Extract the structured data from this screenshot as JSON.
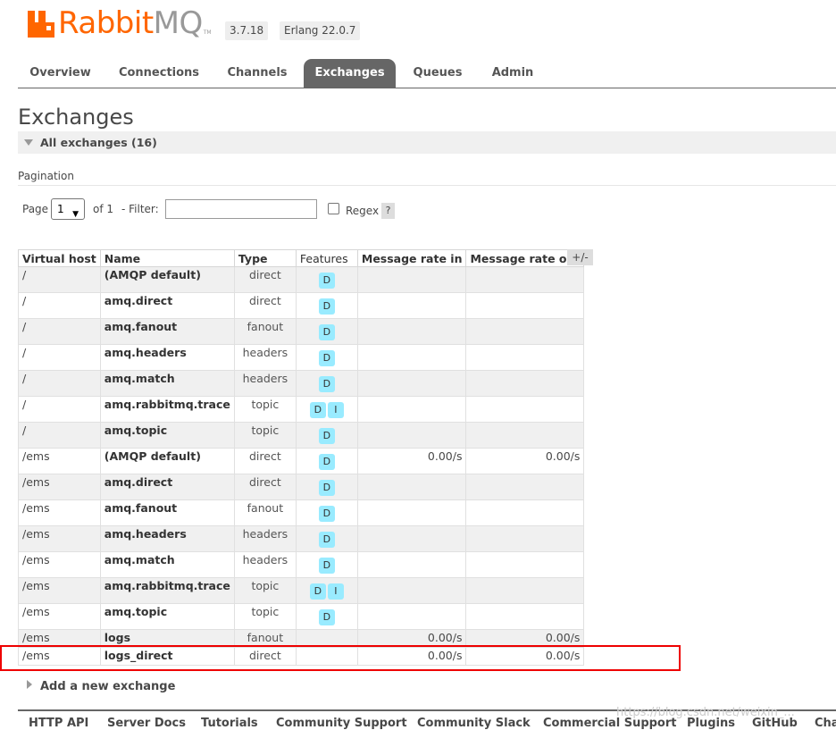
{
  "header": {
    "logo_text_rabbit": "Rabbit",
    "logo_text_mq": "MQ",
    "logo_tm": "TM",
    "version": "3.7.18",
    "erlang": "Erlang 22.0.7"
  },
  "tabs": [
    {
      "label": "Overview"
    },
    {
      "label": "Connections"
    },
    {
      "label": "Channels"
    },
    {
      "label": "Exchanges",
      "active": true
    },
    {
      "label": "Queues"
    },
    {
      "label": "Admin"
    }
  ],
  "page": {
    "title": "Exchanges",
    "section": "All exchanges (16)",
    "pagination_title": "Pagination",
    "page_label": "Page",
    "page_value": "1",
    "of_label": "of 1",
    "filter_label": "- Filter:",
    "filter_value": "",
    "regex_label": "Regex",
    "regex_help": "?"
  },
  "table": {
    "columns": {
      "vhost": "Virtual host",
      "name": "Name",
      "type": "Type",
      "features": "Features",
      "rate_in": "Message rate in",
      "rate_out": "Message rate out"
    },
    "toggle": "+/-",
    "rows": [
      {
        "vhost": "/",
        "name": "(AMQP default)",
        "type": "direct",
        "features": [
          "D"
        ],
        "rate_in": "",
        "rate_out": ""
      },
      {
        "vhost": "/",
        "name": "amq.direct",
        "type": "direct",
        "features": [
          "D"
        ],
        "rate_in": "",
        "rate_out": ""
      },
      {
        "vhost": "/",
        "name": "amq.fanout",
        "type": "fanout",
        "features": [
          "D"
        ],
        "rate_in": "",
        "rate_out": ""
      },
      {
        "vhost": "/",
        "name": "amq.headers",
        "type": "headers",
        "features": [
          "D"
        ],
        "rate_in": "",
        "rate_out": ""
      },
      {
        "vhost": "/",
        "name": "amq.match",
        "type": "headers",
        "features": [
          "D"
        ],
        "rate_in": "",
        "rate_out": ""
      },
      {
        "vhost": "/",
        "name": "amq.rabbitmq.trace",
        "type": "topic",
        "features": [
          "D",
          "I"
        ],
        "rate_in": "",
        "rate_out": ""
      },
      {
        "vhost": "/",
        "name": "amq.topic",
        "type": "topic",
        "features": [
          "D"
        ],
        "rate_in": "",
        "rate_out": ""
      },
      {
        "vhost": "/ems",
        "name": "(AMQP default)",
        "type": "direct",
        "features": [
          "D"
        ],
        "rate_in": "0.00/s",
        "rate_out": "0.00/s"
      },
      {
        "vhost": "/ems",
        "name": "amq.direct",
        "type": "direct",
        "features": [
          "D"
        ],
        "rate_in": "",
        "rate_out": ""
      },
      {
        "vhost": "/ems",
        "name": "amq.fanout",
        "type": "fanout",
        "features": [
          "D"
        ],
        "rate_in": "",
        "rate_out": ""
      },
      {
        "vhost": "/ems",
        "name": "amq.headers",
        "type": "headers",
        "features": [
          "D"
        ],
        "rate_in": "",
        "rate_out": ""
      },
      {
        "vhost": "/ems",
        "name": "amq.match",
        "type": "headers",
        "features": [
          "D"
        ],
        "rate_in": "",
        "rate_out": ""
      },
      {
        "vhost": "/ems",
        "name": "amq.rabbitmq.trace",
        "type": "topic",
        "features": [
          "D",
          "I"
        ],
        "rate_in": "",
        "rate_out": ""
      },
      {
        "vhost": "/ems",
        "name": "amq.topic",
        "type": "topic",
        "features": [
          "D"
        ],
        "rate_in": "",
        "rate_out": ""
      },
      {
        "vhost": "/ems",
        "name": "logs",
        "type": "fanout",
        "features": [],
        "rate_in": "0.00/s",
        "rate_out": "0.00/s"
      },
      {
        "vhost": "/ems",
        "name": "logs_direct",
        "type": "direct",
        "features": [],
        "rate_in": "0.00/s",
        "rate_out": "0.00/s"
      }
    ]
  },
  "add_exchange": "Add a new exchange",
  "footer": {
    "links": [
      "HTTP API",
      "Server Docs",
      "Tutorials",
      "Community Support",
      "Community Slack",
      "Commercial Support",
      "Plugins",
      "GitHub",
      "Cha"
    ]
  },
  "watermark": "https://blog.csdn.net/weixin_..."
}
